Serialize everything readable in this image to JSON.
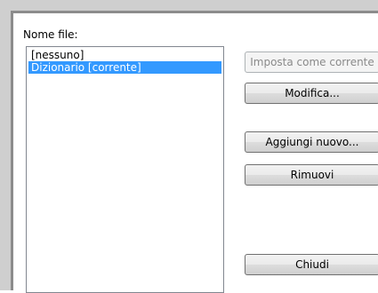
{
  "dialog": {
    "file_name_label": "Nome file:",
    "file_list": [
      {
        "label": "[nessuno]",
        "selected": false
      },
      {
        "label": "Dizionario [corrente]",
        "selected": true
      }
    ],
    "buttons": {
      "set_current": "Imposta come corrente",
      "edit": "Modifica...",
      "add_new": "Aggiungi nuovo...",
      "remove": "Rimuovi",
      "close": "Chiudi"
    }
  },
  "colors": {
    "selection": "#3399ff",
    "selection_text": "#ffffff",
    "disabled_text": "#8a8a8a"
  }
}
